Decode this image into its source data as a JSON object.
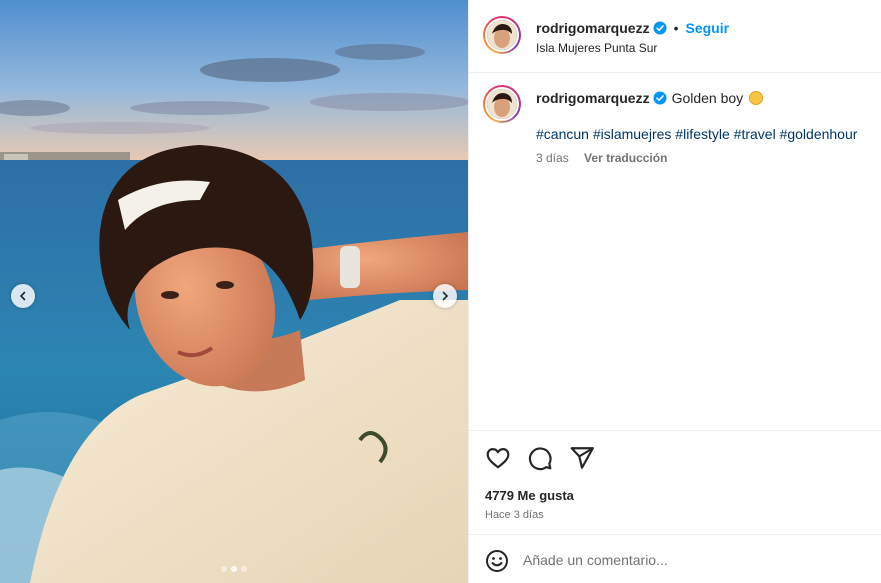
{
  "post": {
    "username": "rodrigomarquezz",
    "verified": true,
    "follow_label": "Seguir",
    "separator": "•",
    "location": "Isla Mujeres Punta Sur"
  },
  "caption": {
    "username": "rodrigomarquezz",
    "text": "Golden boy",
    "hashtags": "#cancun #islamuejres #lifestyle #travel #goldenhour",
    "age": "3 días",
    "translate_label": "Ver traducción"
  },
  "stats": {
    "likes": "4779 Me gusta",
    "time": "Hace 3 días"
  },
  "comment": {
    "placeholder": "Añade un comentario..."
  },
  "carousel": {
    "total_slides": 3,
    "active_index": 1
  },
  "colors": {
    "follow": "#0095f6",
    "hashtag": "#00376b",
    "verified": "#0095f6",
    "muted": "#737373"
  },
  "icons": [
    "verified-badge-icon",
    "chevron-left-icon",
    "chevron-right-icon",
    "heart-icon",
    "comment-icon",
    "share-icon",
    "emoji-icon",
    "sun-emoji-icon"
  ]
}
